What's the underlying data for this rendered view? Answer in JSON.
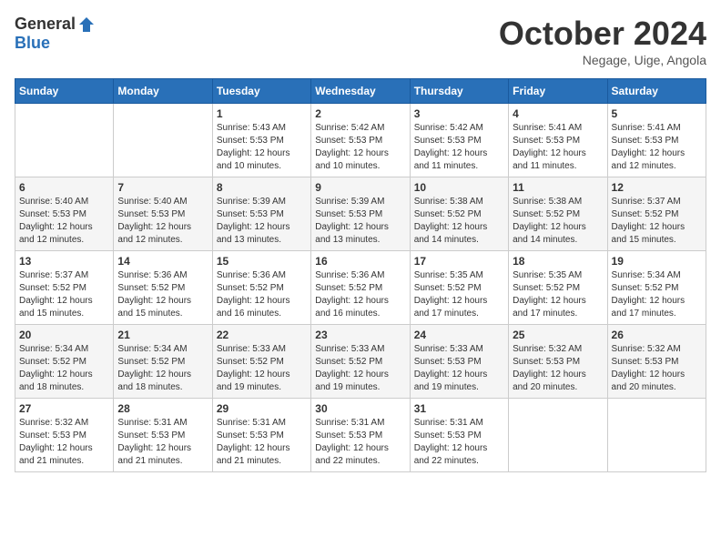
{
  "logo": {
    "general": "General",
    "blue": "Blue"
  },
  "header": {
    "month": "October 2024",
    "location": "Negage, Uige, Angola"
  },
  "weekdays": [
    "Sunday",
    "Monday",
    "Tuesday",
    "Wednesday",
    "Thursday",
    "Friday",
    "Saturday"
  ],
  "weeks": [
    [
      {
        "day": "",
        "info": ""
      },
      {
        "day": "",
        "info": ""
      },
      {
        "day": "1",
        "info": "Sunrise: 5:43 AM\nSunset: 5:53 PM\nDaylight: 12 hours and 10 minutes."
      },
      {
        "day": "2",
        "info": "Sunrise: 5:42 AM\nSunset: 5:53 PM\nDaylight: 12 hours and 10 minutes."
      },
      {
        "day": "3",
        "info": "Sunrise: 5:42 AM\nSunset: 5:53 PM\nDaylight: 12 hours and 11 minutes."
      },
      {
        "day": "4",
        "info": "Sunrise: 5:41 AM\nSunset: 5:53 PM\nDaylight: 12 hours and 11 minutes."
      },
      {
        "day": "5",
        "info": "Sunrise: 5:41 AM\nSunset: 5:53 PM\nDaylight: 12 hours and 12 minutes."
      }
    ],
    [
      {
        "day": "6",
        "info": "Sunrise: 5:40 AM\nSunset: 5:53 PM\nDaylight: 12 hours and 12 minutes."
      },
      {
        "day": "7",
        "info": "Sunrise: 5:40 AM\nSunset: 5:53 PM\nDaylight: 12 hours and 12 minutes."
      },
      {
        "day": "8",
        "info": "Sunrise: 5:39 AM\nSunset: 5:53 PM\nDaylight: 12 hours and 13 minutes."
      },
      {
        "day": "9",
        "info": "Sunrise: 5:39 AM\nSunset: 5:53 PM\nDaylight: 12 hours and 13 minutes."
      },
      {
        "day": "10",
        "info": "Sunrise: 5:38 AM\nSunset: 5:52 PM\nDaylight: 12 hours and 14 minutes."
      },
      {
        "day": "11",
        "info": "Sunrise: 5:38 AM\nSunset: 5:52 PM\nDaylight: 12 hours and 14 minutes."
      },
      {
        "day": "12",
        "info": "Sunrise: 5:37 AM\nSunset: 5:52 PM\nDaylight: 12 hours and 15 minutes."
      }
    ],
    [
      {
        "day": "13",
        "info": "Sunrise: 5:37 AM\nSunset: 5:52 PM\nDaylight: 12 hours and 15 minutes."
      },
      {
        "day": "14",
        "info": "Sunrise: 5:36 AM\nSunset: 5:52 PM\nDaylight: 12 hours and 15 minutes."
      },
      {
        "day": "15",
        "info": "Sunrise: 5:36 AM\nSunset: 5:52 PM\nDaylight: 12 hours and 16 minutes."
      },
      {
        "day": "16",
        "info": "Sunrise: 5:36 AM\nSunset: 5:52 PM\nDaylight: 12 hours and 16 minutes."
      },
      {
        "day": "17",
        "info": "Sunrise: 5:35 AM\nSunset: 5:52 PM\nDaylight: 12 hours and 17 minutes."
      },
      {
        "day": "18",
        "info": "Sunrise: 5:35 AM\nSunset: 5:52 PM\nDaylight: 12 hours and 17 minutes."
      },
      {
        "day": "19",
        "info": "Sunrise: 5:34 AM\nSunset: 5:52 PM\nDaylight: 12 hours and 17 minutes."
      }
    ],
    [
      {
        "day": "20",
        "info": "Sunrise: 5:34 AM\nSunset: 5:52 PM\nDaylight: 12 hours and 18 minutes."
      },
      {
        "day": "21",
        "info": "Sunrise: 5:34 AM\nSunset: 5:52 PM\nDaylight: 12 hours and 18 minutes."
      },
      {
        "day": "22",
        "info": "Sunrise: 5:33 AM\nSunset: 5:52 PM\nDaylight: 12 hours and 19 minutes."
      },
      {
        "day": "23",
        "info": "Sunrise: 5:33 AM\nSunset: 5:52 PM\nDaylight: 12 hours and 19 minutes."
      },
      {
        "day": "24",
        "info": "Sunrise: 5:33 AM\nSunset: 5:53 PM\nDaylight: 12 hours and 19 minutes."
      },
      {
        "day": "25",
        "info": "Sunrise: 5:32 AM\nSunset: 5:53 PM\nDaylight: 12 hours and 20 minutes."
      },
      {
        "day": "26",
        "info": "Sunrise: 5:32 AM\nSunset: 5:53 PM\nDaylight: 12 hours and 20 minutes."
      }
    ],
    [
      {
        "day": "27",
        "info": "Sunrise: 5:32 AM\nSunset: 5:53 PM\nDaylight: 12 hours and 21 minutes."
      },
      {
        "day": "28",
        "info": "Sunrise: 5:31 AM\nSunset: 5:53 PM\nDaylight: 12 hours and 21 minutes."
      },
      {
        "day": "29",
        "info": "Sunrise: 5:31 AM\nSunset: 5:53 PM\nDaylight: 12 hours and 21 minutes."
      },
      {
        "day": "30",
        "info": "Sunrise: 5:31 AM\nSunset: 5:53 PM\nDaylight: 12 hours and 22 minutes."
      },
      {
        "day": "31",
        "info": "Sunrise: 5:31 AM\nSunset: 5:53 PM\nDaylight: 12 hours and 22 minutes."
      },
      {
        "day": "",
        "info": ""
      },
      {
        "day": "",
        "info": ""
      }
    ]
  ]
}
